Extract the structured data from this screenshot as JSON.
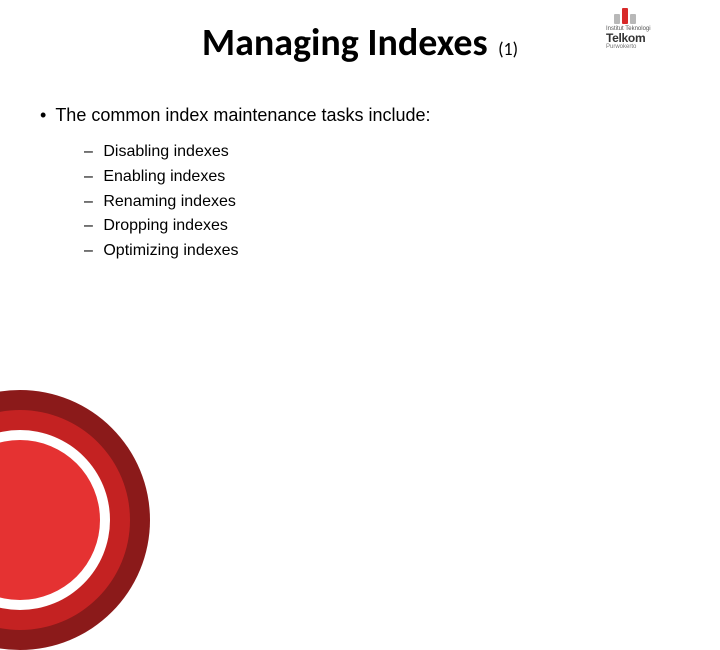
{
  "title": "Managing Indexes",
  "title_num": "(1)",
  "logo": {
    "line1": "Institut Teknologi",
    "line2": "Telkom",
    "line3": "Purwokerto"
  },
  "main_bullet": "The common index maintenance tasks include:",
  "sub_items": [
    "Disabling indexes",
    "Enabling indexes",
    "Renaming indexes",
    "Dropping indexes",
    "Optimizing indexes"
  ],
  "colors": {
    "accent_dark": "#8b1a1a",
    "accent_mid": "#c42222",
    "accent_light": "#e53232"
  }
}
